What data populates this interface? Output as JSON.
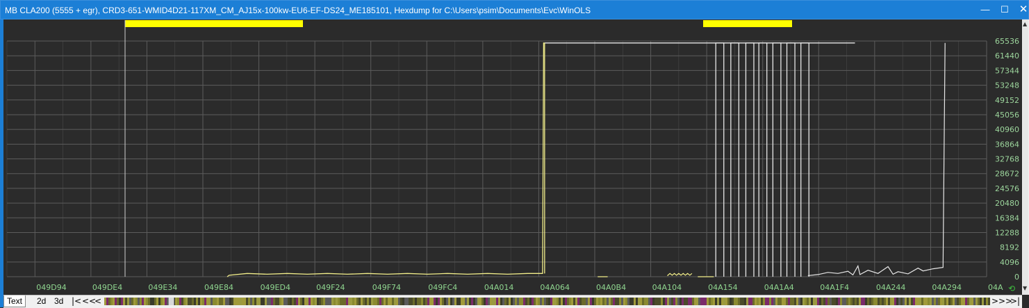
{
  "window": {
    "title": "MB CLA200 (5555 + egr), CRD3-651-WMID4D21-117XM_CM_AJ15x-100kw-EU6-EF-DS24_ME185101, Hexdump for C:\\Users\\psim\\Documents\\Evc\\WinOLS",
    "minimize_glyph": "—",
    "maximize_glyph": "☐",
    "close_glyph": "✕"
  },
  "colors": {
    "accent_title": "#1c7fd6",
    "plot_bg": "#2b2b2b",
    "grid": "#5c5c5c",
    "selection": "#ffff00",
    "series_yellow": "#f2ee8a",
    "series_white": "#e8e8e8",
    "y_label": "#9cd59c",
    "x_label": "#8fd58f"
  },
  "chart_data": {
    "type": "line",
    "x_tick_labels": [
      "049D94",
      "049DE4",
      "049E34",
      "049E84",
      "049ED4",
      "049F24",
      "049F74",
      "049FC4",
      "04A014",
      "04A064",
      "04A0B4",
      "04A104",
      "04A154",
      "04A1A4",
      "04A1F4",
      "04A244",
      "04A294",
      "04A"
    ],
    "y_tick_labels": [
      "65536",
      "61440",
      "57344",
      "53248",
      "49152",
      "45056",
      "40960",
      "36864",
      "32768",
      "28672",
      "24576",
      "20480",
      "16384",
      "12288",
      "8192",
      "4096",
      "0"
    ],
    "ylim": [
      0,
      65536
    ],
    "grid": true,
    "selection_markers": [
      {
        "label": "selection-1",
        "color": "#ffff00"
      },
      {
        "label": "selection-2",
        "color": "#ffff00"
      }
    ],
    "series": [
      {
        "color": "#f2ee8a",
        "segments": [
          {
            "x": [
              0.22,
              0.222,
              0.24,
              0.26,
              0.28,
              0.3,
              0.32,
              0.34,
              0.36,
              0.38,
              0.4,
              0.42,
              0.44,
              0.46,
              0.48,
              0.5,
              0.52,
              0.535,
              0.536,
              0.537
            ],
            "y": [
              0,
              400,
              900,
              700,
              900,
              700,
              900,
              700,
              900,
              700,
              900,
              700,
              900,
              700,
              900,
              700,
              900,
              900,
              65000,
              65000
            ]
          }
        ]
      },
      {
        "color": "#e8e8e8",
        "segments": [
          {
            "x": [
              0.537,
              0.847
            ],
            "y": [
              65000,
              65000
            ]
          }
        ]
      }
    ]
  },
  "bottom": {
    "tab_text": "Text",
    "tab_2d": "2d",
    "tab_3d": "3d",
    "nav_first": "|<",
    "nav_fast_back": "<<",
    "nav_back": "<",
    "nav_forward": ">",
    "nav_fast_forward": ">>",
    "nav_last": ">|"
  }
}
